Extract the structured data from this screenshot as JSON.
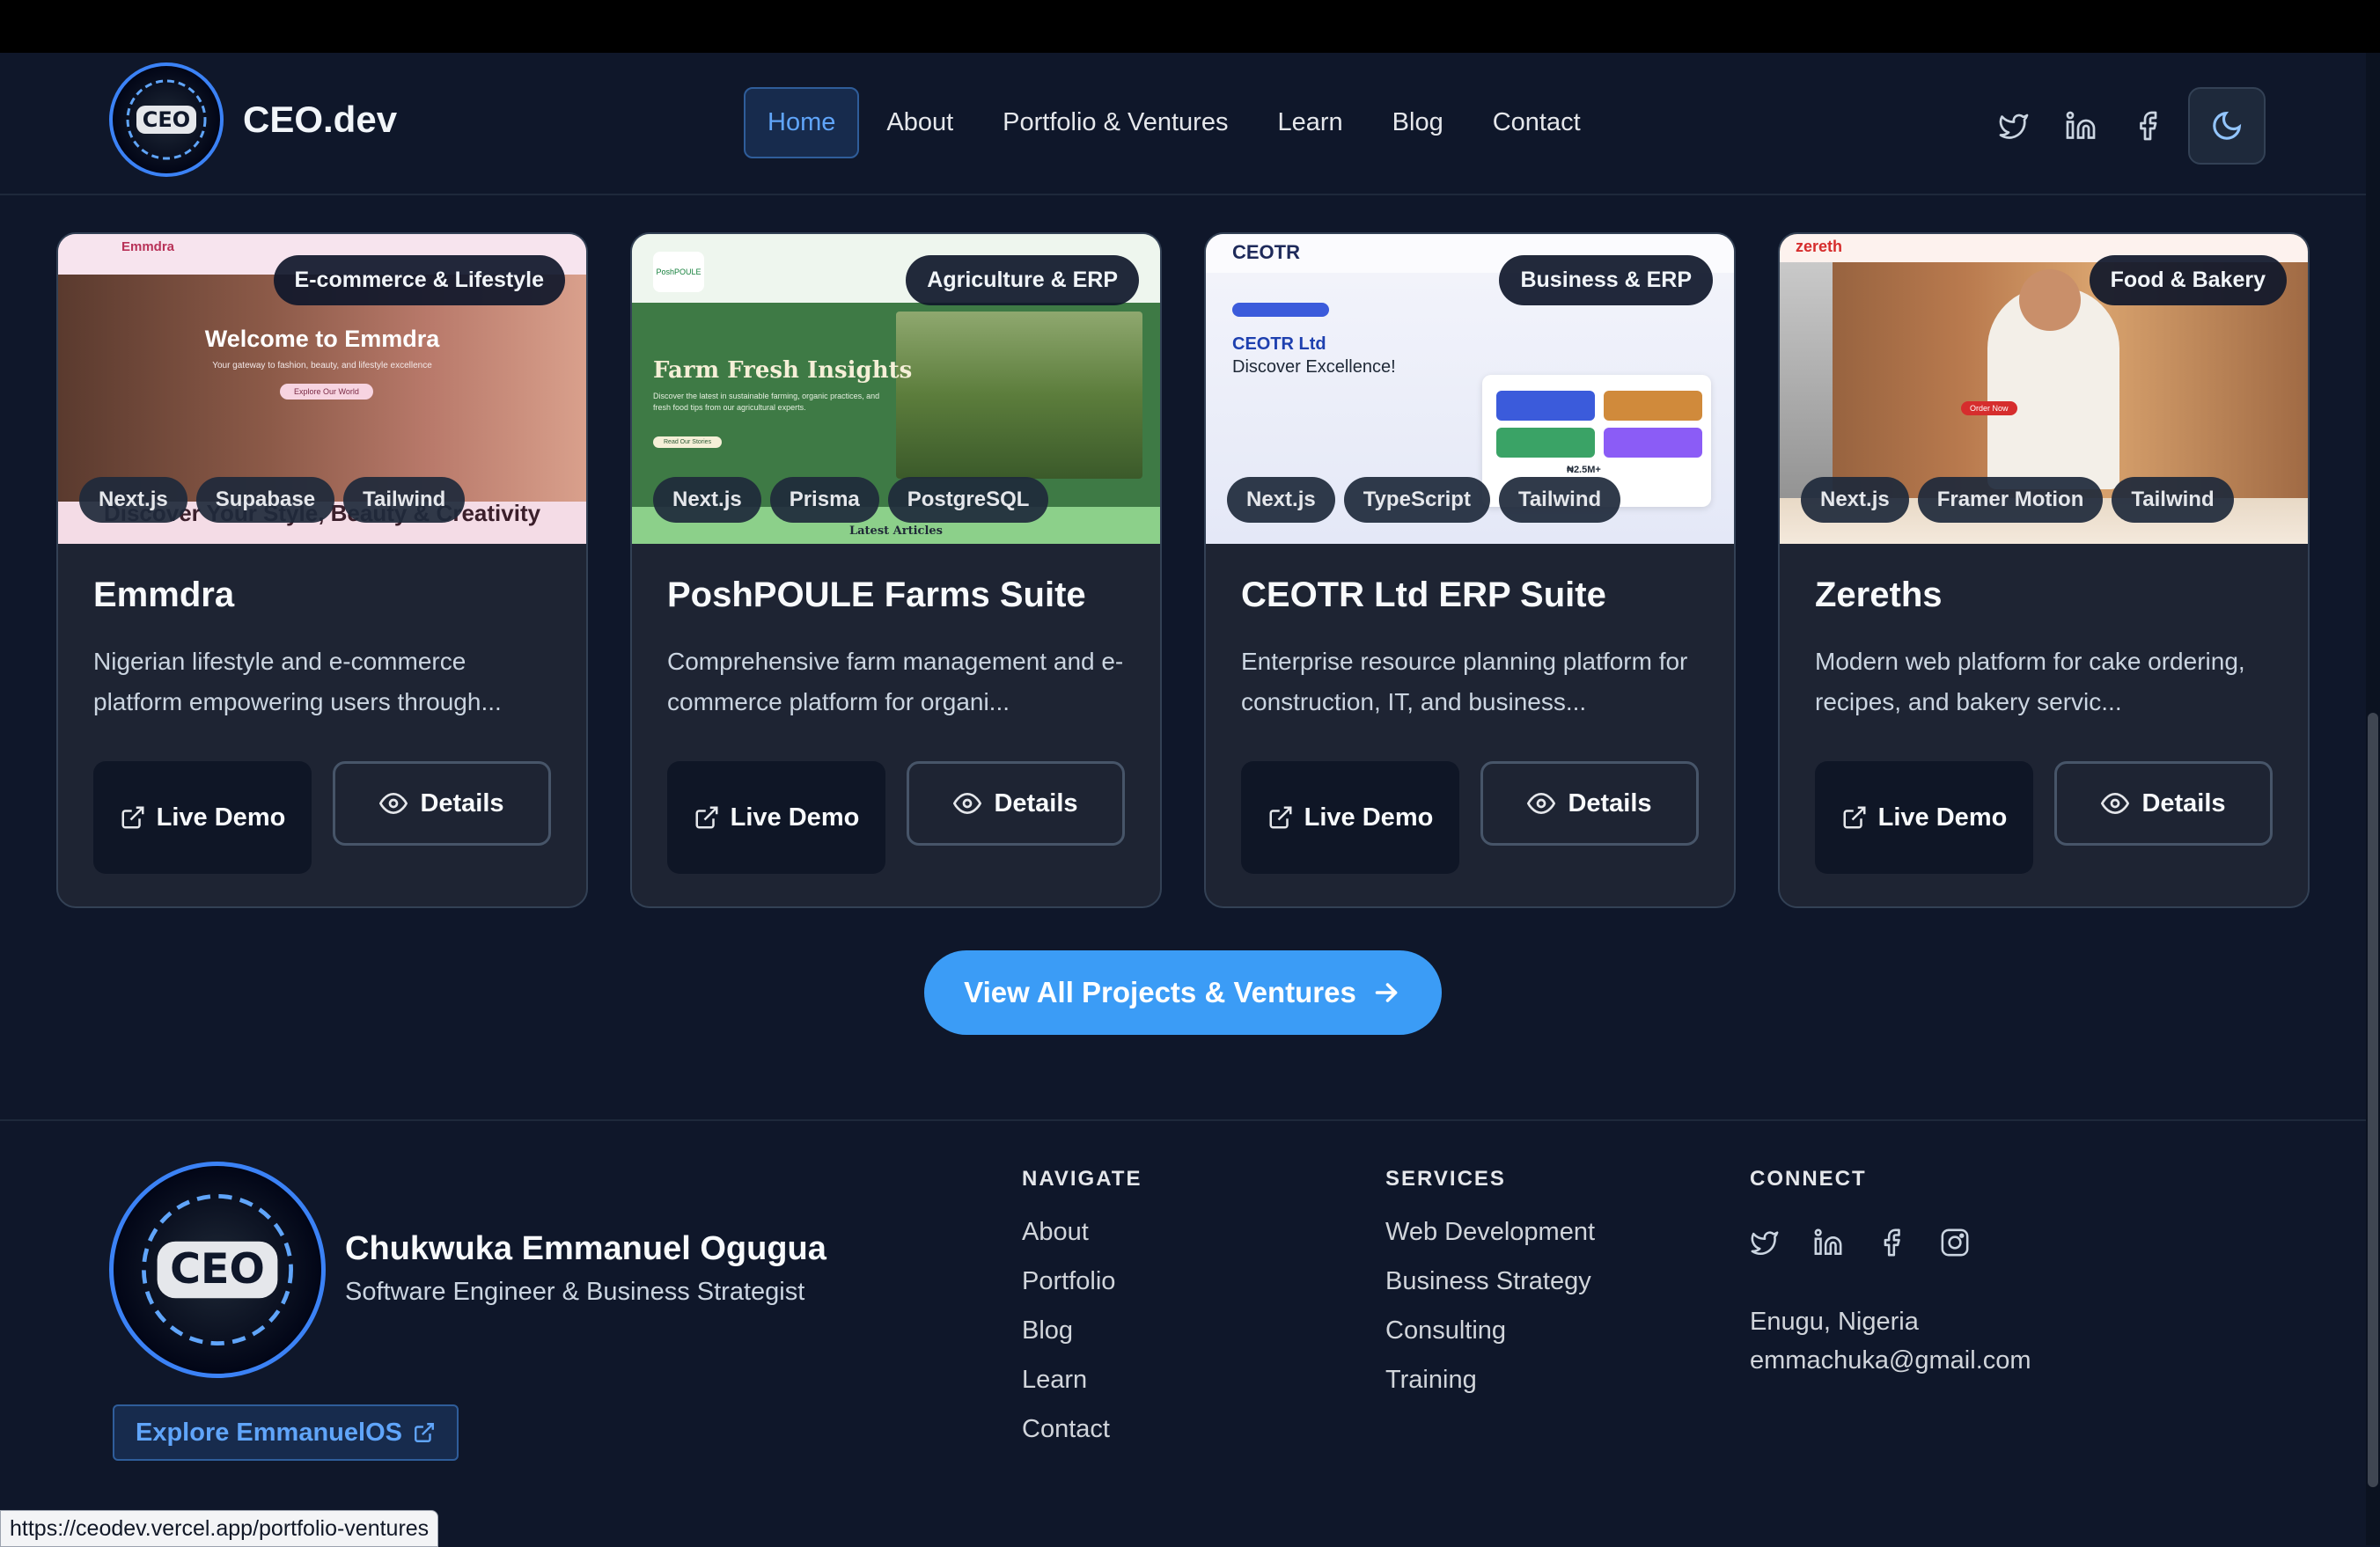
{
  "brand": {
    "name": "CEO.dev",
    "logo_text": "CEO"
  },
  "nav": {
    "links": [
      "Home",
      "About",
      "Portfolio & Ventures",
      "Learn",
      "Blog",
      "Contact"
    ],
    "active": "Home",
    "icons": [
      "twitter-icon",
      "linkedin-icon",
      "facebook-icon"
    ],
    "theme_icon": "moon-icon"
  },
  "projects": [
    {
      "category": "E-commerce & Lifestyle",
      "tech": [
        "Next.js",
        "Supabase",
        "Tailwind"
      ],
      "title": "Emmdra",
      "description": "Nigerian lifestyle and e-commerce platform empowering users through...",
      "thumb": {
        "brand": "Emmdra",
        "heading": "Welcome to Emmdra",
        "sub": "Your gateway to fashion, beauty, and lifestyle excellence",
        "cta": "Explore Our World",
        "footer": "Discover Your Style, Beauty & Creativity"
      }
    },
    {
      "category": "Agriculture & ERP",
      "tech": [
        "Next.js",
        "Prisma",
        "PostgreSQL"
      ],
      "title": "PoshPOULE Farms Suite",
      "description": "Comprehensive farm management and e-commerce platform for organi...",
      "thumb": {
        "brand": "PoshPOULE",
        "heading": "Farm Fresh Insights",
        "sub": "Discover the latest in sustainable farming, organic practices, and fresh food tips from our agricultural experts.",
        "cta": "Read Our Stories",
        "footer": "Latest Articles"
      }
    },
    {
      "category": "Business & ERP",
      "tech": [
        "Next.js",
        "TypeScript",
        "Tailwind"
      ],
      "title": "CEOTR Ltd ERP Suite",
      "description": "Enterprise resource planning platform for construction, IT, and business...",
      "thumb": {
        "brand": "CEOTR",
        "heading": "CEOTR Ltd",
        "sub": "Discover Excellence!",
        "cta": "",
        "footer": "₦2.5M+"
      }
    },
    {
      "category": "Food & Bakery",
      "tech": [
        "Next.js",
        "Framer Motion",
        "Tailwind"
      ],
      "title": "Zereths",
      "description": "Modern web platform for cake ordering, recipes, and bakery servic...",
      "thumb": {
        "brand": "zereth",
        "heading": "",
        "sub": "",
        "cta": "Order Now",
        "footer": ""
      }
    }
  ],
  "actions": {
    "live_demo": "Live Demo",
    "details": "Details"
  },
  "cta": {
    "label": "View All Projects & Ventures"
  },
  "footer": {
    "name": "Chukwuka Emmanuel Ogugua",
    "role": "Software Engineer & Business Strategist",
    "explore": "Explore EmmanuelOS",
    "navigate": {
      "heading": "NAVIGATE",
      "items": [
        "About",
        "Portfolio",
        "Blog",
        "Learn",
        "Contact"
      ]
    },
    "services": {
      "heading": "SERVICES",
      "items": [
        "Web Development",
        "Business Strategy",
        "Consulting",
        "Training"
      ]
    },
    "connect": {
      "heading": "CONNECT",
      "icons": [
        "twitter-icon",
        "linkedin-icon",
        "facebook-icon",
        "instagram-icon"
      ],
      "location": "Enugu, Nigeria",
      "email": "emmachuka@gmail.com"
    }
  },
  "status_url": "https://ceodev.vercel.app/portfolio-ventures",
  "colors": {
    "accent": "#3b9cf6",
    "background": "#0f172a",
    "card": "#1e2433"
  }
}
